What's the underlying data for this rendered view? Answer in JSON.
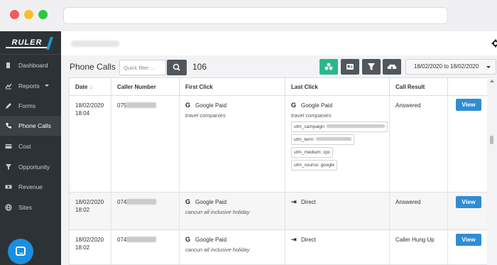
{
  "app": {
    "brand": "RULER"
  },
  "sidebar": {
    "items": [
      {
        "label": "Dashboard",
        "icon": "dashboard-icon"
      },
      {
        "label": "Reports",
        "icon": "chart-icon"
      },
      {
        "label": "Forms",
        "icon": "pencil-icon"
      },
      {
        "label": "Phone Calls",
        "icon": "phone-icon"
      },
      {
        "label": "Cost",
        "icon": "card-icon"
      },
      {
        "label": "Opportunity",
        "icon": "funnel-icon"
      },
      {
        "label": "Revenue",
        "icon": "money-icon"
      },
      {
        "label": "Sites",
        "icon": "globe-icon"
      }
    ]
  },
  "toolbar": {
    "title": "Phone Calls",
    "filter_placeholder": "Quick filter ...",
    "count": "106",
    "date_range": "18/02/2020 to 18/02/2020"
  },
  "table": {
    "headers": {
      "date": "Date",
      "caller": "Caller Number",
      "first": "First Click",
      "last": "Last Click",
      "result": "Call Result"
    },
    "view_label": "View",
    "rows": [
      {
        "date": "18/02/2020",
        "time": "18:04",
        "caller_prefix": "075",
        "first_source": "Google Paid",
        "first_detail": "travel companies",
        "last_source": "Google Paid",
        "last_detail": "travel companies",
        "utm": [
          "utm_campaign:",
          "utm_term:",
          "utm_medium: cpc",
          "utm_source: google"
        ],
        "result": "Answered"
      },
      {
        "date": "18/02/2020",
        "time": "18:02",
        "caller_prefix": "074",
        "first_source": "Google Paid",
        "first_detail": "cancun all inclusive holiday",
        "last_source": "Direct",
        "last_detail": "",
        "result": "Answered"
      },
      {
        "date": "18/02/2020",
        "time": "18:02",
        "caller_prefix": "074",
        "first_source": "Google Paid",
        "first_detail": "cancun all inclusive holiday",
        "last_source": "Direct",
        "last_detail": "",
        "result": "Caller Hung Up"
      }
    ]
  },
  "colors": {
    "sidebar": "#2d3236",
    "accent_teal": "#2bb78a",
    "view_button": "#2f8dd1"
  }
}
